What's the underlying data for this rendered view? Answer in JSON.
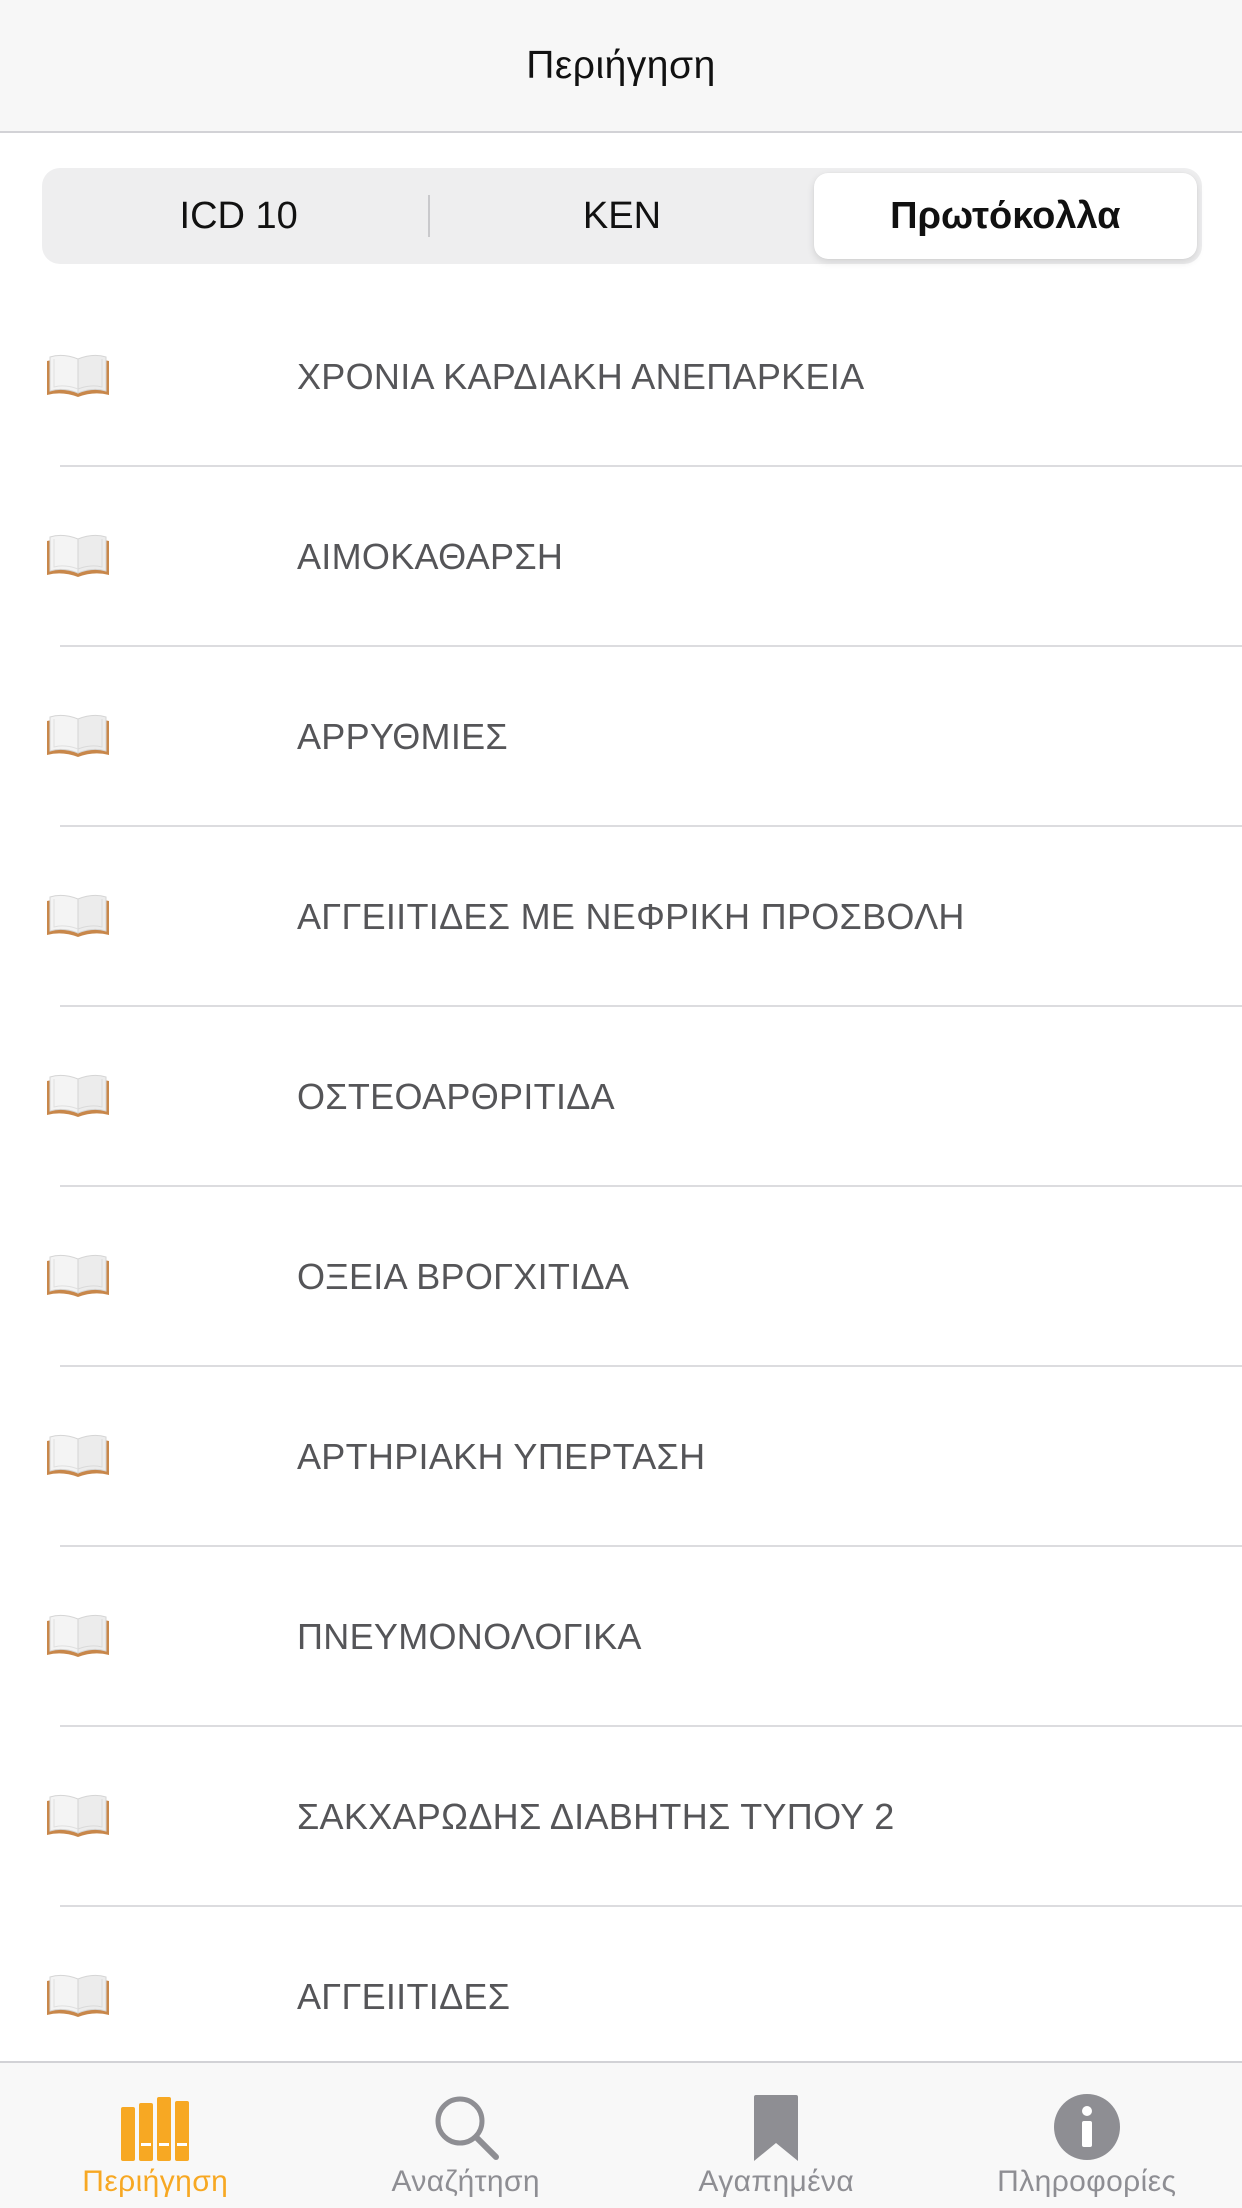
{
  "navbar": {
    "title": "Περιήγηση"
  },
  "segments": [
    {
      "label": "ICD 10",
      "selected": false
    },
    {
      "label": "ΚΕΝ",
      "selected": false
    },
    {
      "label": "Πρωτόκολλα",
      "selected": true
    }
  ],
  "list": {
    "items": [
      {
        "label": "ΧΡΟΝΙΑ ΚΑΡΔΙΑΚΗ ΑΝΕΠΑΡΚΕΙΑ",
        "icon": "book-icon"
      },
      {
        "label": "ΑΙΜΟΚΑΘΑΡΣΗ",
        "icon": "book-icon"
      },
      {
        "label": "ΑΡΡΥΘΜΙΕΣ",
        "icon": "book-icon"
      },
      {
        "label": "ΑΓΓΕΙΙΤΙΔΕΣ ΜΕ ΝΕΦΡΙΚΗ ΠΡΟΣΒΟΛΗ",
        "icon": "book-icon"
      },
      {
        "label": "ΟΣΤΕΟΑΡΘΡΙΤΙΔΑ",
        "icon": "book-icon"
      },
      {
        "label": "ΟΞΕΙΑ ΒΡΟΓΧΙΤΙΔΑ",
        "icon": "book-icon"
      },
      {
        "label": "ΑΡΤΗΡΙΑΚΗ ΥΠΕΡΤΑΣΗ",
        "icon": "book-icon"
      },
      {
        "label": "ΠΝΕΥΜΟΝΟΛΟΓΙΚΑ",
        "icon": "book-icon"
      },
      {
        "label": "ΣΑΚΧΑΡΩΔΗΣ ΔΙΑΒΗΤΗΣ ΤΥΠΟΥ 2",
        "icon": "book-icon"
      },
      {
        "label": "ΑΓΓΕΙΙΤΙΔΕΣ",
        "icon": "book-icon"
      }
    ]
  },
  "tabbar": {
    "tabs": [
      {
        "label": "Περιήγηση",
        "icon": "library-icon",
        "active": true
      },
      {
        "label": "Αναζήτηση",
        "icon": "search-icon",
        "active": false
      },
      {
        "label": "Αγαπημένα",
        "icon": "bookmark-icon",
        "active": false
      },
      {
        "label": "Πληροφορίες",
        "icon": "info-icon",
        "active": false
      }
    ]
  },
  "colors": {
    "accent": "#f7a823",
    "inactive": "#8e8e93",
    "item_text": "#555558",
    "book_cover": "#c8874a"
  }
}
